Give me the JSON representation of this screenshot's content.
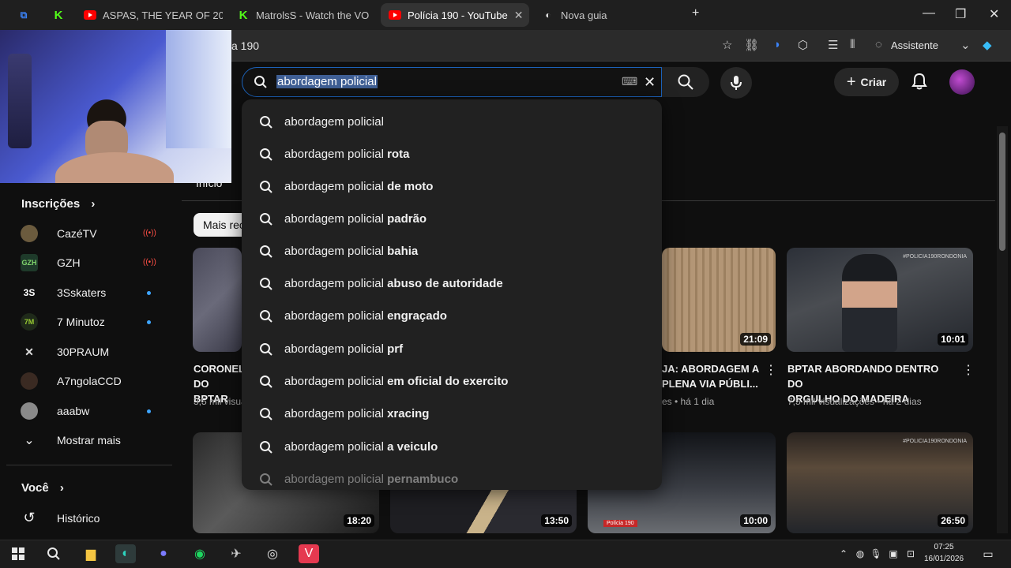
{
  "browser": {
    "tabs": [
      {
        "label": "",
        "icon": "edge-icon"
      },
      {
        "label": "",
        "icon": "kick-icon"
      },
      {
        "label": "ASPAS, THE YEAR OF 20",
        "icon": "youtube-icon"
      },
      {
        "label": "MatrolsS - Watch the VO",
        "icon": "kick-icon"
      },
      {
        "label": "Polícia 190 - YouTube",
        "icon": "youtube-icon",
        "active": true
      },
      {
        "label": "Nova guia",
        "icon": "newtab-icon"
      }
    ],
    "address_text": "a 190",
    "assistant_label": "Assistente"
  },
  "youtube": {
    "search_value": "abordagem policial",
    "create_label": "Criar",
    "suggestions": [
      {
        "bold": "abordagem policial",
        "rest": ""
      },
      {
        "bold": "abordagem policial",
        "rest": " rota"
      },
      {
        "bold": "abordagem policial",
        "rest": " de moto"
      },
      {
        "bold": "abordagem policial",
        "rest": " padrão"
      },
      {
        "bold": "abordagem policial",
        "rest": " bahia"
      },
      {
        "bold": "abordagem policial",
        "rest": " abuso de autoridade"
      },
      {
        "bold": "abordagem policial",
        "rest": " engraçado"
      },
      {
        "bold": "abordagem policial",
        "rest": " prf"
      },
      {
        "bold": "abordagem policial",
        "rest": " em oficial do exercito"
      },
      {
        "bold": "abordagem policial",
        "rest": " xracing"
      },
      {
        "bold": "abordagem policial",
        "rest": " a veiculo"
      },
      {
        "bold": "abordagem policial",
        "rest": " pernambuco"
      }
    ],
    "sidebar": {
      "subscriptions_label": "Inscrições",
      "channels": [
        {
          "name": "CazéTV",
          "badge": "live"
        },
        {
          "name": "GZH",
          "badge": "live"
        },
        {
          "name": "3Sskaters",
          "badge": "dot"
        },
        {
          "name": "7 Minutoz",
          "badge": "dot"
        },
        {
          "name": "30PRAUM",
          "badge": ""
        },
        {
          "name": "A7ngolaCCD",
          "badge": ""
        },
        {
          "name": "aaabw",
          "badge": "dot"
        }
      ],
      "show_more_label": "Mostrar mais",
      "you_label": "Você",
      "history_label": "Histórico"
    },
    "channel_tab_label": "Início",
    "chip_label": "Mais rec",
    "videos": [
      {
        "title_line1": "CORONEL",
        "title_line2": "DO BPTAR",
        "meta": "3,5 mil visua",
        "duration": ""
      },
      {
        "title_line1": "JA: ABORDAGEM A",
        "title_line2": "PLENA VIA PÚBLI...",
        "meta": "es • há 1 dia",
        "duration": "21:09"
      },
      {
        "title_line1": "BPTAR ABORDANDO DENTRO DO",
        "title_line2": "ORGULHO DO MADEIRA",
        "meta": "7,5 mil visualizações • há 2 dias",
        "duration": "10:01"
      },
      {
        "duration": "18:20"
      },
      {
        "duration": "13:50"
      },
      {
        "duration": "10:00"
      },
      {
        "duration": "26:50"
      }
    ],
    "thumb_watermark": "#POLICIA190RONDONIA",
    "thumb_channel_tag": "Polícia 190"
  },
  "taskbar": {
    "time": "07:25",
    "date": "16/01/2026"
  },
  "colors": {
    "youtube_red": "#ff0000",
    "focus_blue": "#1c62b9",
    "kick_green": "#53fc18"
  }
}
